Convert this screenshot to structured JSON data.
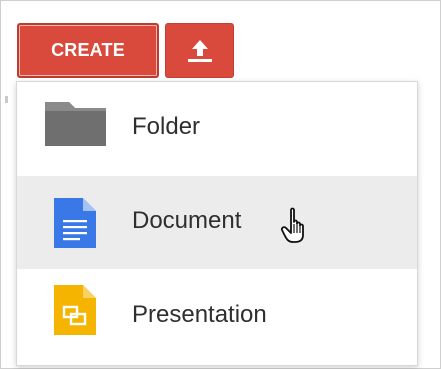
{
  "toolbar": {
    "create_label": "CREATE",
    "upload_icon": "upload-icon"
  },
  "menu": {
    "items": [
      {
        "label": "Folder",
        "icon": "folder-icon"
      },
      {
        "label": "Document",
        "icon": "document-icon"
      },
      {
        "label": "Presentation",
        "icon": "presentation-icon"
      }
    ],
    "highlighted_item": "Document"
  },
  "colors": {
    "button_red": "#d94a3d",
    "highlight_gray": "#ececec",
    "folder_gray": "#777777",
    "document_blue": "#3b78e7",
    "presentation_yellow": "#f4b400"
  },
  "pointer": {
    "icon": "hand-cursor-icon"
  }
}
